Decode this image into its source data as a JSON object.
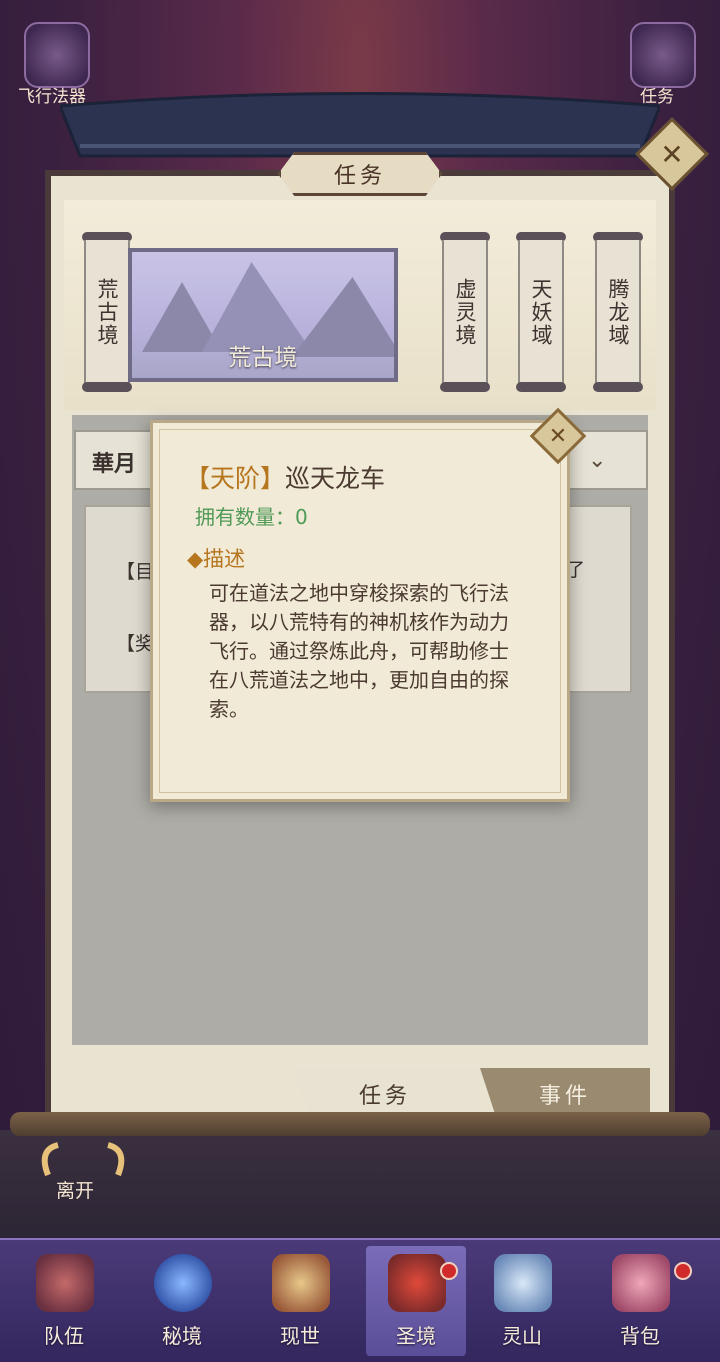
{
  "top_icons": {
    "left_label": "飞行法器",
    "right_label": "任务"
  },
  "frame": {
    "title": "任务"
  },
  "map": {
    "selected_region": "荒古境",
    "caption": "荒古境",
    "regions": [
      "虚灵境",
      "天妖域",
      "腾龙域"
    ]
  },
  "task_panel": {
    "tab_label": "華月",
    "row1_left": "【目",
    "row1_right": "了",
    "row2_left": "【奖"
  },
  "tooltip": {
    "grade": "【天阶】",
    "name": "巡天龙车",
    "owned": "拥有数量：0",
    "desc_heading": "◆描述",
    "desc_text": "可在道法之地中穿梭探索的飞行法器，以八荒特有的神机核作为动力飞行。通过祭炼此舟，可帮助修士在八荒道法之地中，更加自由的探索。"
  },
  "bottom_tabs": {
    "task": "任务",
    "event": "事件"
  },
  "leave_label": "离开",
  "nav": {
    "items": [
      {
        "label": "队伍"
      },
      {
        "label": "秘境"
      },
      {
        "label": "现世"
      },
      {
        "label": "圣境"
      },
      {
        "label": "灵山"
      },
      {
        "label": "背包"
      }
    ],
    "active_index": 3
  },
  "colors": {
    "accent_gold": "#b6761e",
    "owned_green": "#4f9a56",
    "nav_bg": "#3a2d6a"
  }
}
